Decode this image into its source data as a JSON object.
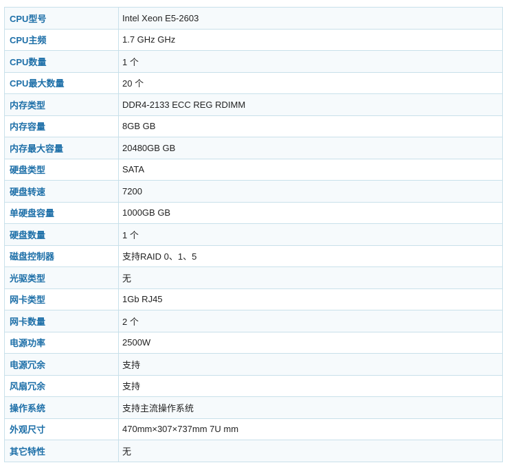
{
  "specs": [
    {
      "label": "CPU型号",
      "value": "Intel Xeon E5-2603"
    },
    {
      "label": "CPU主频",
      "value": "1.7 GHz  GHz"
    },
    {
      "label": "CPU数量",
      "value": "1  个"
    },
    {
      "label": "CPU最大数量",
      "value": "20  个"
    },
    {
      "label": "内存类型",
      "value": "DDR4-2133 ECC REG RDIMM"
    },
    {
      "label": "内存容量",
      "value": "8GB  GB"
    },
    {
      "label": "内存最大容量",
      "value": "20480GB  GB"
    },
    {
      "label": "硬盘类型",
      "value": "SATA"
    },
    {
      "label": "硬盘转速",
      "value": "7200"
    },
    {
      "label": "单硬盘容量",
      "value": "1000GB  GB"
    },
    {
      "label": "硬盘数量",
      "value": "1  个"
    },
    {
      "label": "磁盘控制器",
      "value": "支持RAID 0、1、5"
    },
    {
      "label": "光驱类型",
      "value": "无"
    },
    {
      "label": "网卡类型",
      "value": "1Gb RJ45"
    },
    {
      "label": "网卡数量",
      "value": "2  个"
    },
    {
      "label": "电源功率",
      "value": "2500W"
    },
    {
      "label": "电源冗余",
      "value": "支持"
    },
    {
      "label": "风扇冗余",
      "value": "支持"
    },
    {
      "label": "操作系统",
      "value": "支持主流操作系统"
    },
    {
      "label": "外观尺寸",
      "value": "470mm×307×737mm 7U  mm"
    },
    {
      "label": "其它特性",
      "value": "无"
    }
  ],
  "colors": {
    "label_text": "#1d6fa8",
    "border": "#c8e0ea",
    "row_alt": "#f6fafc"
  }
}
